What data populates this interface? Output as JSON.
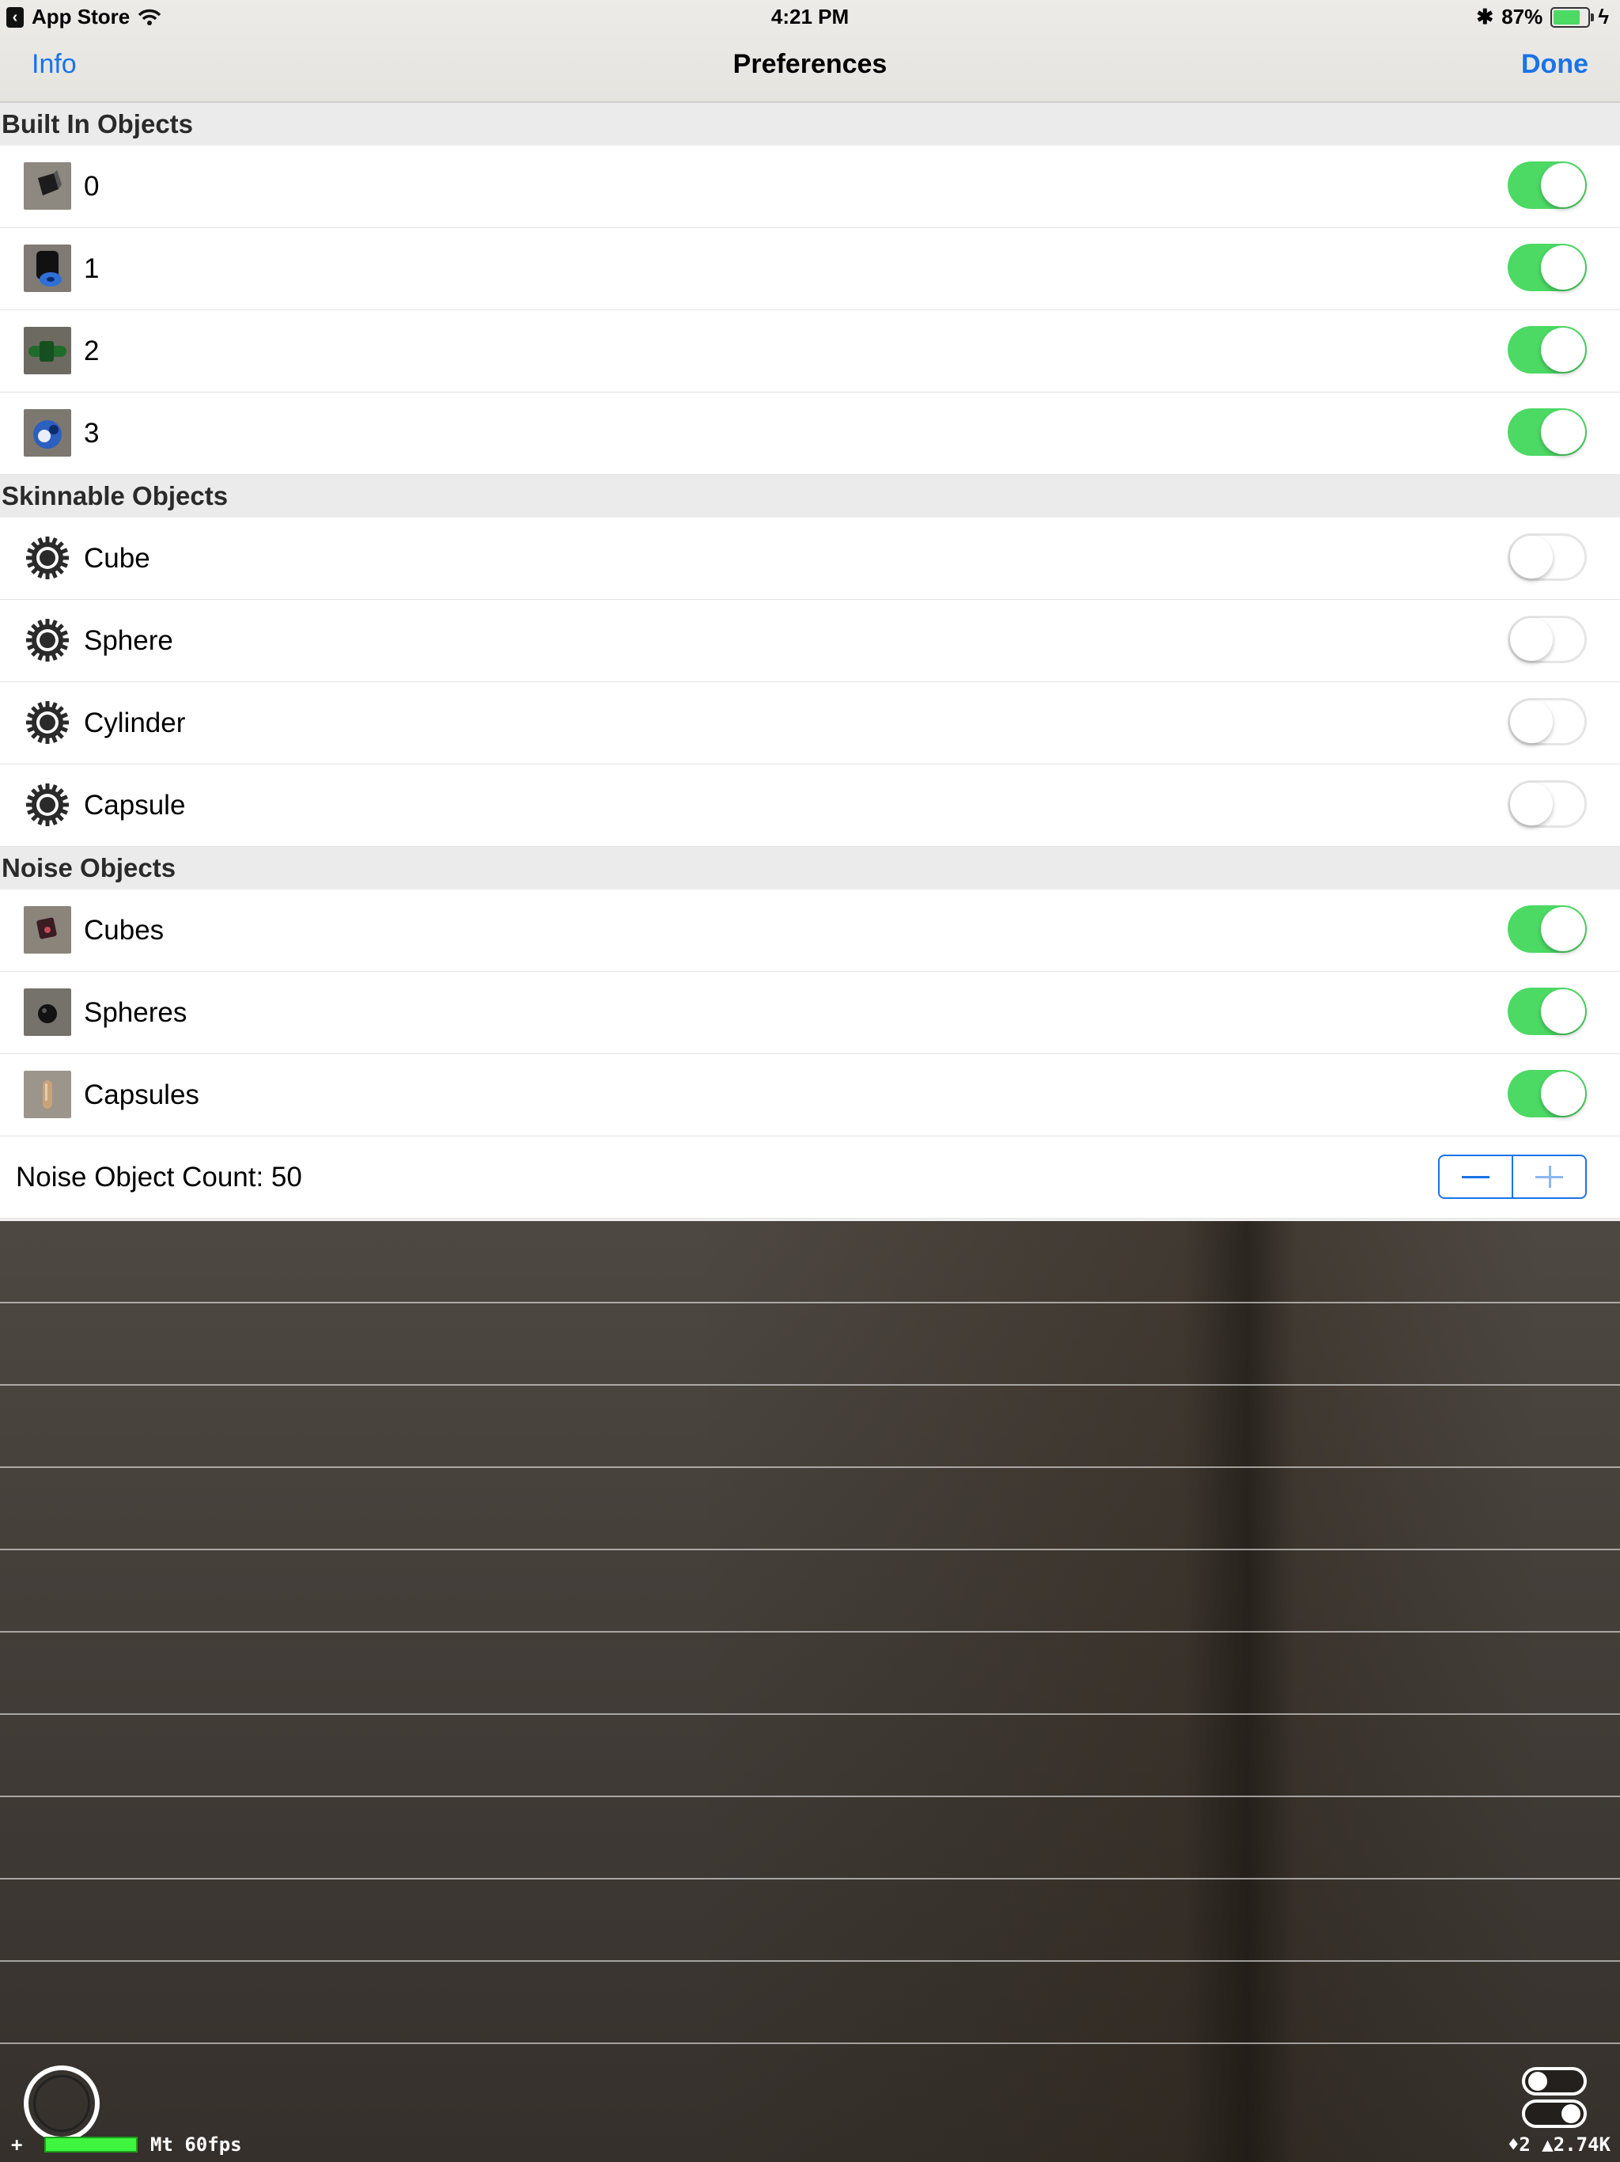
{
  "status_bar": {
    "back_app": "App Store",
    "time": "4:21 PM",
    "battery_percent": "87%",
    "battery_level": 0.87,
    "icons": [
      "wifi-icon",
      "bluetooth-icon",
      "battery-icon",
      "charging-icon"
    ]
  },
  "nav": {
    "left": "Info",
    "title": "Preferences",
    "right": "Done"
  },
  "sections": [
    {
      "header": "Built In Objects",
      "rows": [
        {
          "label": "0",
          "on": true
        },
        {
          "label": "1",
          "on": true
        },
        {
          "label": "2",
          "on": true
        },
        {
          "label": "3",
          "on": true
        }
      ]
    },
    {
      "header": "Skinnable Objects",
      "rows": [
        {
          "label": "Cube",
          "on": false
        },
        {
          "label": "Sphere",
          "on": false
        },
        {
          "label": "Cylinder",
          "on": false
        },
        {
          "label": "Capsule",
          "on": false
        }
      ]
    },
    {
      "header": "Noise Objects",
      "rows": [
        {
          "label": "Cubes",
          "on": true
        },
        {
          "label": "Spheres",
          "on": true
        },
        {
          "label": "Capsules",
          "on": true
        }
      ]
    }
  ],
  "noise_count": {
    "label": "Noise Object Count: 50"
  },
  "overlay": {
    "fps": "Mt 60fps",
    "plus": "+",
    "stats": "♦2 ▲2.74K"
  },
  "colors": {
    "accent": "#1a73e8",
    "toggle_on": "#4cd964"
  }
}
